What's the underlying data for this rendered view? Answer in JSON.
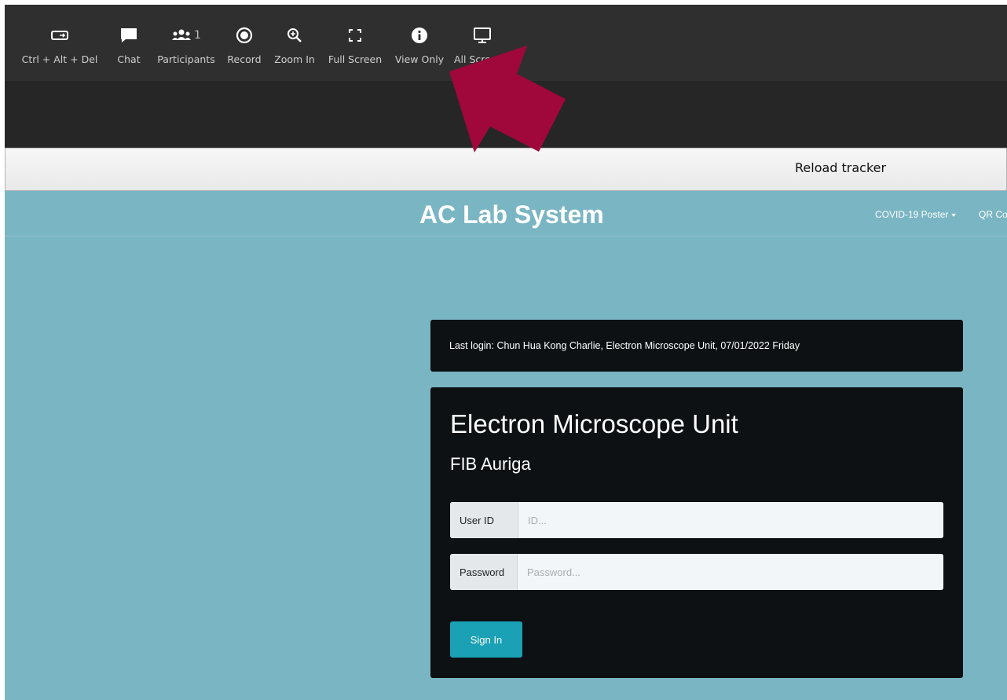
{
  "toolbar": {
    "items": [
      {
        "label": "Ctrl + Alt + Del",
        "icon": "keyboard-icon"
      },
      {
        "label": "Chat",
        "icon": "chat-icon"
      },
      {
        "label": "Participants",
        "icon": "participants-icon",
        "count": "1"
      },
      {
        "label": "Record",
        "icon": "record-icon"
      },
      {
        "label": "Zoom In",
        "icon": "zoom-in-icon"
      },
      {
        "label": "Full Screen",
        "icon": "fullscreen-icon"
      },
      {
        "label": "View Only",
        "icon": "info-icon"
      },
      {
        "label": "All Scre",
        "icon": "monitor-icon"
      }
    ]
  },
  "reload": {
    "label": "Reload tracker"
  },
  "site": {
    "brand": "AC Lab System",
    "nav": [
      {
        "label": "COVID-19 Poster"
      },
      {
        "label": "QR Co"
      }
    ]
  },
  "last_login": "Last login: Chun Hua Kong Charlie, Electron Microscope Unit, 07/01/2022 Friday",
  "login": {
    "title": "Electron Microscope Unit",
    "subtitle": "FIB Auriga",
    "user_id_label": "User ID",
    "user_id_placeholder": "ID...",
    "password_label": "Password",
    "password_placeholder": "Password...",
    "sign_in_label": "Sign In"
  },
  "colors": {
    "toolbar_bg": "#2f2f2f",
    "page_bg": "#7ab5c3",
    "card_bg": "#0d1114",
    "button": "#1aa1b5",
    "arrow": "#a0073b"
  }
}
